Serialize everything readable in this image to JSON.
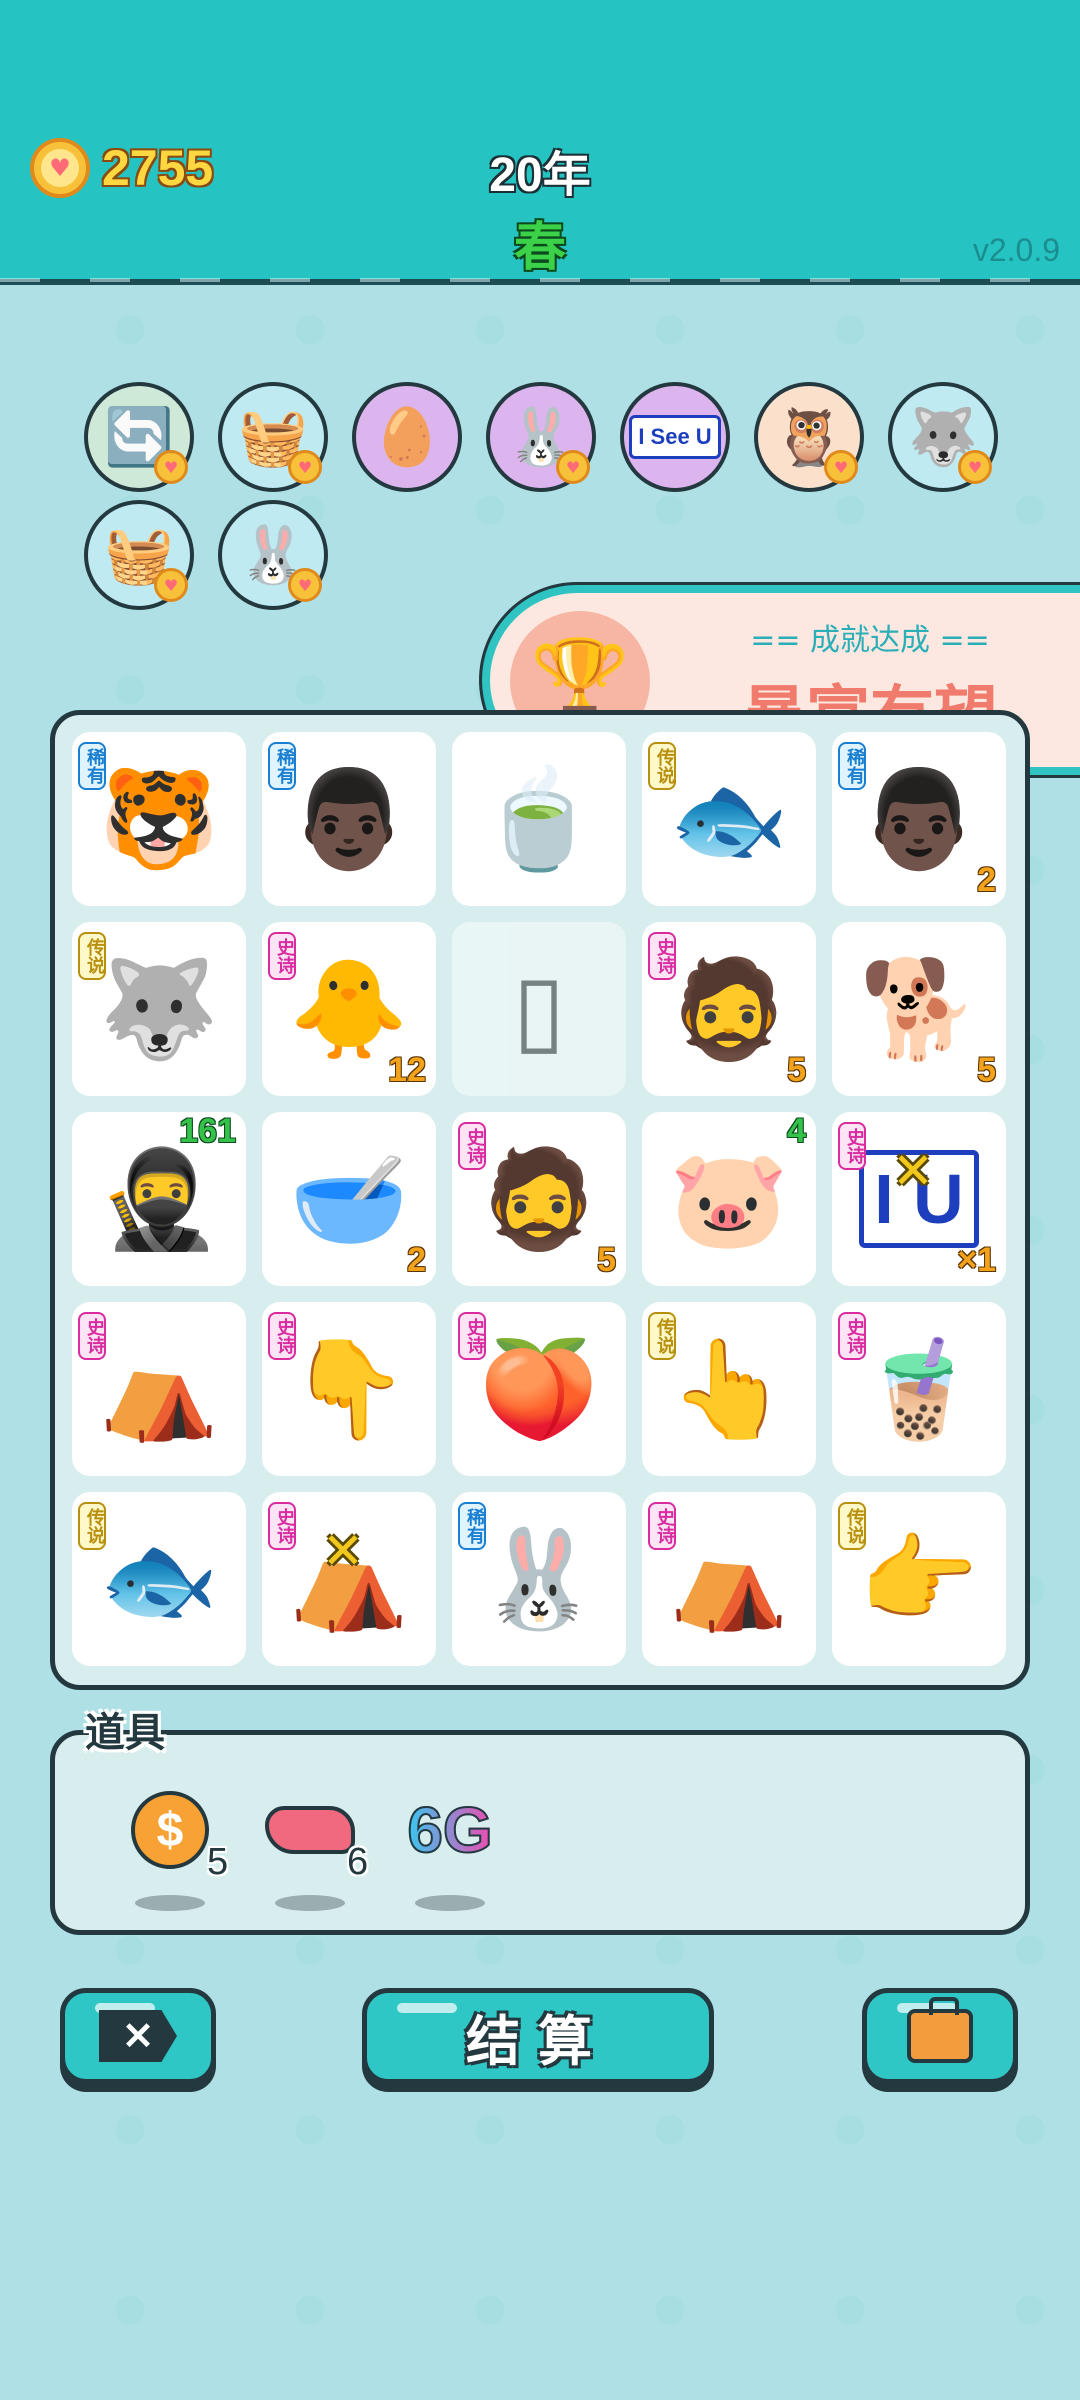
{
  "header": {
    "coins": "2755",
    "year": "20年",
    "season": "春",
    "version": "v2.0.9"
  },
  "relics": [
    {
      "icon": "refresh-icon",
      "glyph": "🔄",
      "bg": "#cfe9d8",
      "heart": true
    },
    {
      "icon": "fruit-basket-icon",
      "glyph": "🧺",
      "bg": "#bfeaf2",
      "heart": true
    },
    {
      "icon": "egg-icon",
      "glyph": "🥚",
      "bg": "#ddb5ee",
      "heart": false
    },
    {
      "icon": "rabbit-icon",
      "glyph": "🐰",
      "bg": "#ddb5ee",
      "heart": true
    },
    {
      "icon": "i-see-u-icon",
      "text": "I See U",
      "bg": "#ddb5ee",
      "heart": false
    },
    {
      "icon": "owl-goggles-icon",
      "glyph": "🦉",
      "bg": "#fbe0cc",
      "heart": true
    },
    {
      "icon": "husky-icon",
      "glyph": "🐺",
      "bg": "#bfeaf2",
      "heart": true
    },
    {
      "icon": "fruit-basket-icon",
      "glyph": "🧺",
      "bg": "#bfeaf2",
      "heart": true
    },
    {
      "icon": "rabbit-icon",
      "glyph": "🐰",
      "bg": "#bfeaf2",
      "heart": true
    }
  ],
  "achievement": {
    "subtitle": "== 成就达成 ==",
    "title": "暴富有望",
    "icon": "trophy-icon"
  },
  "rarity_labels": {
    "rare": "稀有",
    "epic": "史诗",
    "legend": "传说"
  },
  "board": [
    {
      "icon": "tiger-icon",
      "glyph": "🐯",
      "rarity": "rare",
      "count": ""
    },
    {
      "icon": "bucket-hat-man-icon",
      "glyph": "👨🏿",
      "rarity": "rare",
      "count": ""
    },
    {
      "icon": "tea-bag-icon",
      "glyph": "🍵",
      "rarity": "",
      "count": ""
    },
    {
      "icon": "koi-fish-icon",
      "glyph": "🐟",
      "rarity": "legend",
      "count": ""
    },
    {
      "icon": "bucket-hat-man-icon",
      "glyph": "👨🏿",
      "rarity": "rare",
      "count": "2"
    },
    {
      "icon": "husky-king-icon",
      "glyph": "🐺",
      "rarity": "legend",
      "count": ""
    },
    {
      "icon": "lucky-chick-icon",
      "glyph": "🐥",
      "rarity": "epic",
      "count": "12"
    },
    {
      "icon": "empty-slot-icon",
      "glyph": "▯",
      "rarity": "",
      "count": "",
      "faded": true
    },
    {
      "icon": "green-hat-man-icon",
      "glyph": "🧔",
      "rarity": "epic",
      "count": "5"
    },
    {
      "icon": "brown-dog-icon",
      "glyph": "🐕",
      "rarity": "",
      "count": "5"
    },
    {
      "icon": "thief-icon",
      "glyph": "🥷",
      "rarity": "",
      "count": "161",
      "countTop": true
    },
    {
      "icon": "soup-bowl-icon",
      "glyph": "🥣",
      "rarity": "",
      "count": "2"
    },
    {
      "icon": "green-hat-man-icon",
      "glyph": "🧔",
      "rarity": "epic",
      "count": "5"
    },
    {
      "icon": "pig-icon",
      "glyph": "🐷",
      "rarity": "",
      "count": "4",
      "countTop": true
    },
    {
      "icon": "i-see-u-icon",
      "text": "I U",
      "rarity": "epic",
      "count": "×1"
    },
    {
      "icon": "rabbit-tent-icon",
      "glyph": "⛺",
      "rarity": "epic",
      "count": ""
    },
    {
      "icon": "pointing-down-hand-icon",
      "glyph": "👇",
      "rarity": "epic",
      "count": ""
    },
    {
      "icon": "peach-icon",
      "glyph": "🍑",
      "rarity": "epic",
      "count": ""
    },
    {
      "icon": "pointing-hand-icon",
      "glyph": "👆",
      "rarity": "legend",
      "count": ""
    },
    {
      "icon": "bubble-tea-icon",
      "glyph": "🧋",
      "rarity": "epic",
      "count": ""
    },
    {
      "icon": "koi-fish-icon",
      "glyph": "🐟",
      "rarity": "legend",
      "count": ""
    },
    {
      "icon": "rabbit-tent-icon",
      "glyph": "⛺",
      "rarity": "epic",
      "count": ""
    },
    {
      "icon": "rabbit-icon",
      "glyph": "🐰",
      "rarity": "rare",
      "count": ""
    },
    {
      "icon": "rabbit-tent-icon",
      "glyph": "⛺",
      "rarity": "epic",
      "count": ""
    },
    {
      "icon": "pointing-right-hand-icon",
      "glyph": "👉",
      "rarity": "legend",
      "count": ""
    }
  ],
  "items_panel": {
    "title": "道具",
    "items": [
      {
        "icon": "dollar-coin-icon",
        "count": "5"
      },
      {
        "icon": "liver-icon",
        "count": "6"
      },
      {
        "icon": "6g-icon",
        "text": "6G",
        "count": ""
      }
    ]
  },
  "buttons": {
    "exit_icon": "exit-icon",
    "exit_glyph": "✕",
    "settle_label": "结算",
    "bag_icon": "briefcase-icon"
  },
  "colors": {
    "header_bg": "#25c4c2",
    "body_bg": "#aee0e6",
    "accent_gold": "#ffd740",
    "season_green": "#3bd24a",
    "achievement_title": "#f07b6c"
  }
}
